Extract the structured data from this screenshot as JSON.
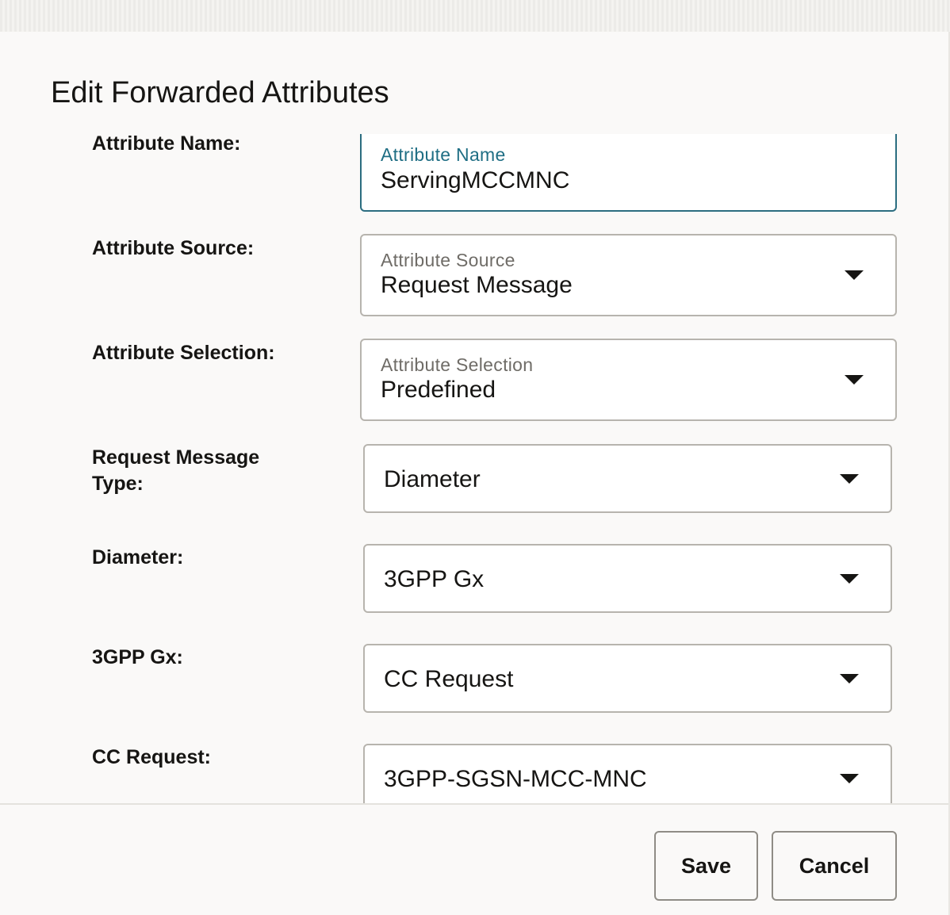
{
  "dialog": {
    "title": "Edit Forwarded Attributes"
  },
  "form": {
    "attribute_name": {
      "row_label": "Attribute Name:",
      "field_label": "Attribute Name",
      "value": "ServingMCCMNC"
    },
    "attribute_source": {
      "row_label": "Attribute Source:",
      "field_label": "Attribute Source",
      "value": "Request Message"
    },
    "attribute_selection": {
      "row_label": "Attribute Selection:",
      "field_label": "Attribute Selection",
      "value": "Predefined"
    },
    "request_message_type": {
      "row_label_line1": "Request Message",
      "row_label_line2": "Type:",
      "value": "Diameter"
    },
    "diameter": {
      "row_label": "Diameter:",
      "value": "3GPP Gx"
    },
    "gx": {
      "row_label": "3GPP Gx:",
      "value": "CC Request"
    },
    "cc_request": {
      "row_label": "CC Request:",
      "value": "3GPP-SGSN-MCC-MNC"
    }
  },
  "footer": {
    "save_label": "Save",
    "cancel_label": "Cancel"
  },
  "icons": {
    "dropdown": "chevron-down-icon"
  },
  "colors": {
    "focus_accent": "#1f6e84",
    "field_border": "#b7b4ae",
    "text": "#161513"
  }
}
